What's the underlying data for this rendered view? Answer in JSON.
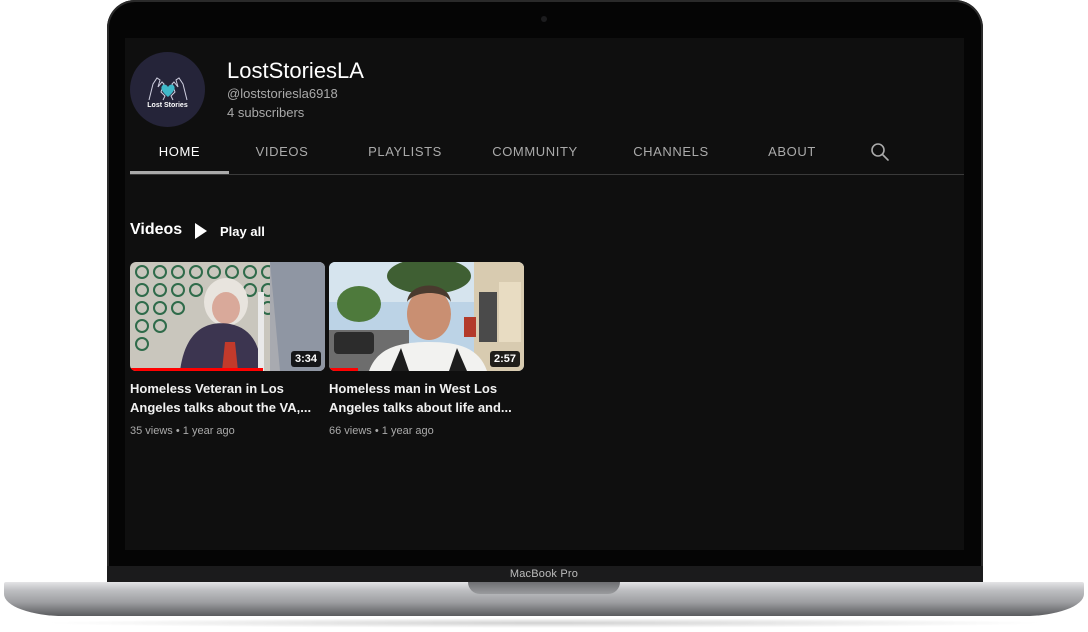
{
  "device": {
    "model_label": "MacBook Pro"
  },
  "channel": {
    "name": "LostStoriesLA",
    "handle": "@loststoriesla6918",
    "subscribers": "4 subscribers",
    "avatar": {
      "text": "Lost Stories",
      "icon": "hands-heart-icon",
      "bg_color": "#252439",
      "heart_color": "#3fb8c9"
    }
  },
  "tabs": [
    {
      "label": "HOME",
      "active": true
    },
    {
      "label": "VIDEOS",
      "active": false
    },
    {
      "label": "PLAYLISTS",
      "active": false
    },
    {
      "label": "COMMUNITY",
      "active": false
    },
    {
      "label": "CHANNELS",
      "active": false
    },
    {
      "label": "ABOUT",
      "active": false
    }
  ],
  "search_icon": "search-icon",
  "section": {
    "title": "Videos",
    "play_all_label": "Play all"
  },
  "videos": [
    {
      "title": "Homeless Veteran in Los Angeles talks about the VA,...",
      "duration": "3:34",
      "views": "35 views",
      "age": "1 year ago",
      "watched_fraction": 0.68
    },
    {
      "title": "Homeless man in West Los Angeles talks about life and...",
      "duration": "2:57",
      "views": "66 views",
      "age": "1 year ago",
      "watched_fraction": 0.15
    }
  ],
  "colors": {
    "background": "#0f0f0f",
    "text_primary": "#ffffff",
    "text_secondary": "#aaaaaa",
    "progress": "#ff0000"
  }
}
